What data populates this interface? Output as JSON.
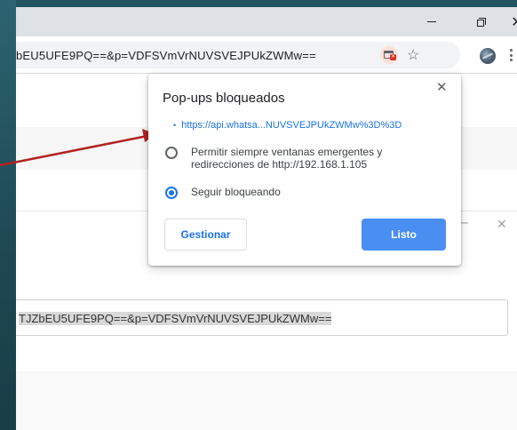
{
  "window": {
    "minimize_glyph": "–",
    "close_glyph": "✕"
  },
  "omnibox": {
    "url": "bEU5UFE9PQ==&p=VDFSVmVrNUVSVEJPUkZWMw=="
  },
  "popup": {
    "title": "Pop-ups bloqueados",
    "close_glyph": "✕",
    "blocked_link": "https://api.whatsa...NUVSVEJPUkZWMw%3D%3D",
    "option_always_allow": "Permitir siempre ventanas emergentes y redirecciones de http://192.168.1.105",
    "option_keep_blocking": "Seguir bloqueando",
    "selected_option": "Seguir bloqueando",
    "manage_button": "Gestionar",
    "done_button": "Listo"
  },
  "page": {
    "side_minimize_glyph": "–",
    "side_close_glyph": "✕",
    "url_field_value": "TJZbEU5UFE9PQ==&p=VDFSVmVrNUVSVEJPUkZWMw=="
  },
  "icons": {
    "popup_blocked": "popup-blocked-icon",
    "bookmark": "star-icon",
    "extension": "extension-icon",
    "menu": "kebab-menu-icon"
  },
  "colors": {
    "accent": "#1a73e8",
    "done_button": "#4a8ef2",
    "arrow": "#b22222",
    "frame": "#1f4a54"
  }
}
